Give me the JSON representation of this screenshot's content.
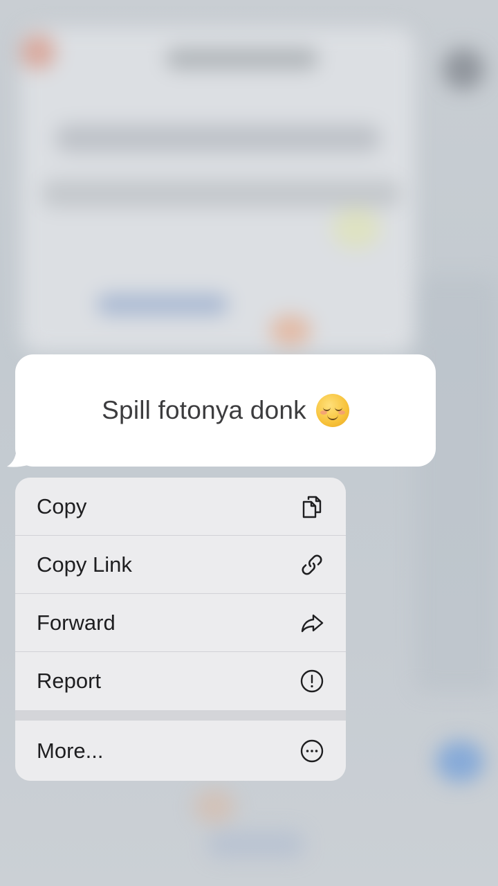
{
  "message": {
    "text": "Spill fotonya donk",
    "emoji": "smiling-face-icon"
  },
  "menu": {
    "items": [
      {
        "label": "Copy",
        "icon": "copy-icon"
      },
      {
        "label": "Copy Link",
        "icon": "link-icon"
      },
      {
        "label": "Forward",
        "icon": "forward-arrow-icon"
      },
      {
        "label": "Report",
        "icon": "exclamation-circle-icon"
      }
    ],
    "more": {
      "label": "More...",
      "icon": "more-ellipsis-icon"
    }
  }
}
